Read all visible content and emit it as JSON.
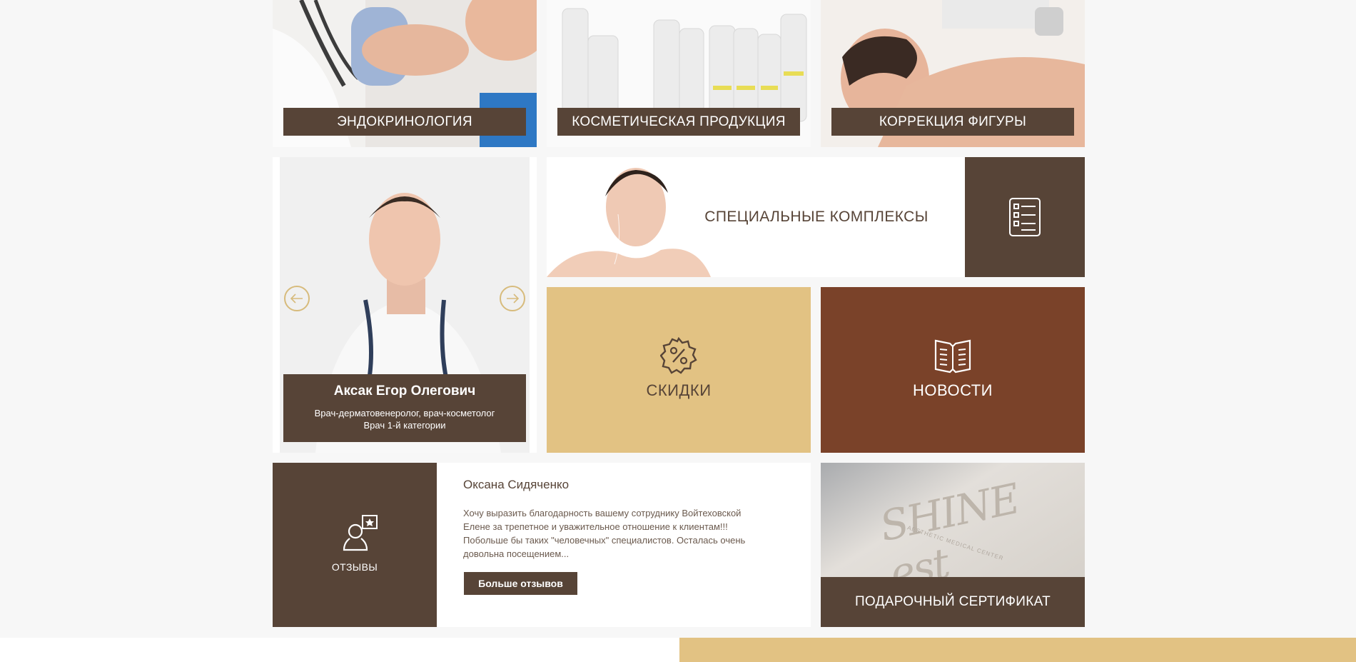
{
  "categories": {
    "endocrinology": "ЭНДОКРИНОЛОГИЯ",
    "cosmetics": "КОСМЕТИЧЕСКАЯ ПРОДУКЦИЯ",
    "body_correction": "КОРРЕКЦИЯ ФИГУРЫ"
  },
  "doctor": {
    "name": "Аксак Егор Олегович",
    "position": "Врач-дерматовенеролог, врач-косметолог",
    "category": "Врач 1-й категории"
  },
  "special": {
    "label": "СПЕЦИАЛЬНЫЕ КОМПЛЕКСЫ"
  },
  "discounts": {
    "label": "СКИДКИ"
  },
  "news": {
    "label": "НОВОСТИ"
  },
  "reviews": {
    "label": "ОТЗЫВЫ",
    "author": "Оксана Сидяченко",
    "text": "Хочу выразить благодарность вашему сотруднику Войтеховской Елене за трепетное и уважительное отношение к клиентам!!! Побольше бы таких \"человечных\" специалистов. Осталась очень довольна посещением...",
    "more_button": "Больше отзывов"
  },
  "gift": {
    "logo_text": "SHINE est",
    "logo_subtext": "AESTHETIC MEDICAL CENTER",
    "label": "ПОДАРОЧНЫЙ СЕРТИФИКАТ"
  },
  "colors": {
    "dark_brown": "#574437",
    "rust": "#7a4229",
    "gold": "#e2c283",
    "background": "#f7f7f7"
  }
}
